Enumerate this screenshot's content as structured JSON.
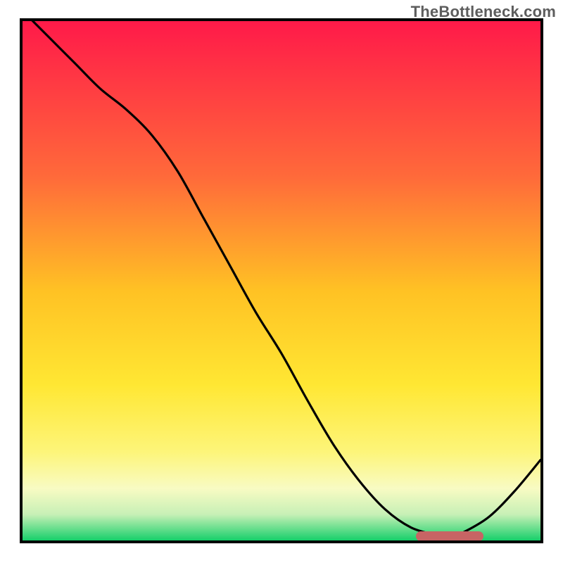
{
  "watermark": "TheBottleneck.com",
  "chart_data": {
    "type": "line",
    "x": [
      0.0,
      0.05,
      0.1,
      0.15,
      0.2,
      0.25,
      0.3,
      0.35,
      0.4,
      0.45,
      0.5,
      0.55,
      0.6,
      0.65,
      0.7,
      0.75,
      0.8,
      0.825,
      0.85,
      0.9,
      0.95,
      1.0
    ],
    "values": [
      1.02,
      0.97,
      0.92,
      0.87,
      0.83,
      0.78,
      0.71,
      0.62,
      0.53,
      0.44,
      0.36,
      0.27,
      0.185,
      0.115,
      0.06,
      0.025,
      0.01,
      0.005,
      0.015,
      0.045,
      0.095,
      0.155
    ],
    "title": "",
    "xlabel": "",
    "ylabel": "",
    "xlim": [
      0,
      1
    ],
    "ylim": [
      0,
      1
    ],
    "marker": {
      "x_start": 0.76,
      "x_end": 0.89,
      "y": 0.008
    },
    "background_gradient": {
      "stops": [
        {
          "pos": 0.0,
          "color": "#ff1a49"
        },
        {
          "pos": 0.3,
          "color": "#ff6a3a"
        },
        {
          "pos": 0.52,
          "color": "#ffc224"
        },
        {
          "pos": 0.7,
          "color": "#ffe733"
        },
        {
          "pos": 0.83,
          "color": "#fdf57a"
        },
        {
          "pos": 0.9,
          "color": "#f8fbc3"
        },
        {
          "pos": 0.95,
          "color": "#c7f0b6"
        },
        {
          "pos": 1.0,
          "color": "#16cf6a"
        }
      ]
    }
  }
}
